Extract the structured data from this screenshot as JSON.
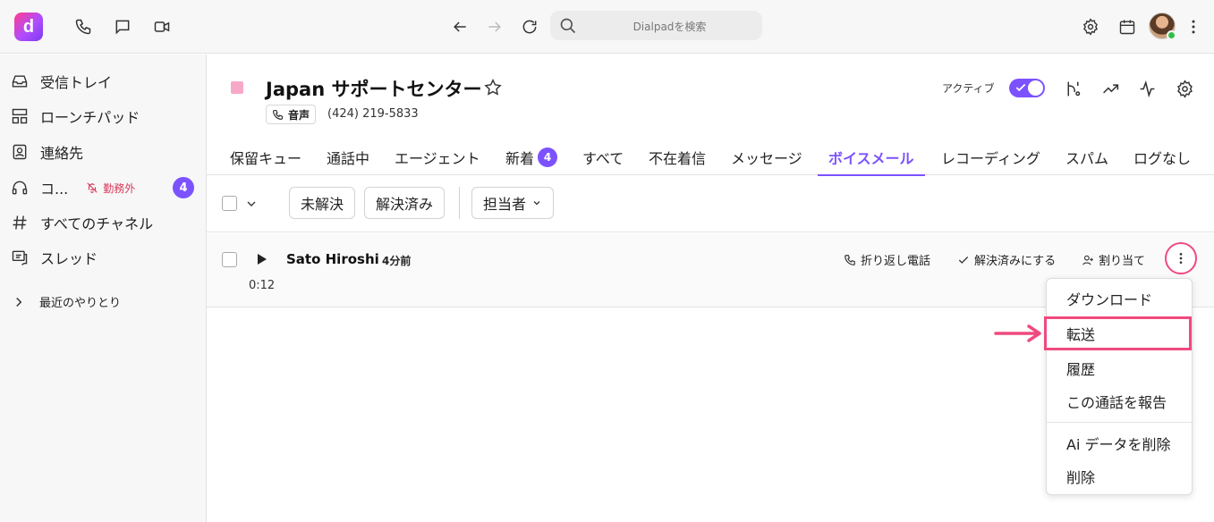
{
  "topbar": {
    "logo_letter": "d",
    "search_placeholder": "Dialpadを検索"
  },
  "sidebar": {
    "items": [
      {
        "label": "受信トレイ",
        "icon": "inbox-icon"
      },
      {
        "label": "ローンチパッド",
        "icon": "launchpad-icon"
      },
      {
        "label": "連絡先",
        "icon": "contacts-icon"
      },
      {
        "label": "コ...",
        "icon": "headset-icon",
        "status": "勤務外",
        "badge": "4"
      },
      {
        "label": "すべてのチャネル",
        "icon": "hash-icon"
      },
      {
        "label": "スレッド",
        "icon": "threads-icon"
      }
    ],
    "recent": "最近のやりとり"
  },
  "header": {
    "title": "Japan サポートセンター",
    "voice_chip": "音声",
    "phone": "(424) 219-5833",
    "active_label": "アクティブ",
    "active": true
  },
  "tabs": [
    {
      "label": "保留キュー"
    },
    {
      "label": "通話中"
    },
    {
      "label": "エージェント"
    },
    {
      "label": "新着",
      "badge": "4"
    },
    {
      "label": "すべて"
    },
    {
      "label": "不在着信"
    },
    {
      "label": "メッセージ"
    },
    {
      "label": "ボイスメール",
      "active": true
    },
    {
      "label": "レコーディング"
    },
    {
      "label": "スパム"
    },
    {
      "label": "ログなし"
    }
  ],
  "filters": {
    "unresolved": "未解決",
    "resolved": "解決済み",
    "assignee": "担当者"
  },
  "voicemail": {
    "caller": "Sato Hiroshi",
    "ago": "4分前",
    "duration": "0:12",
    "call_back": "折り返し電話",
    "mark_resolved": "解決済みにする",
    "assign": "割り当て"
  },
  "menu": {
    "items": [
      "ダウンロード",
      "転送",
      "履歴",
      "この通話を報告",
      "Ai データを削除",
      "削除"
    ],
    "highlighted": "転送"
  },
  "colors": {
    "accent": "#7c52ff",
    "highlight": "#ef4a7f",
    "off_duty": "#d63a5a"
  }
}
